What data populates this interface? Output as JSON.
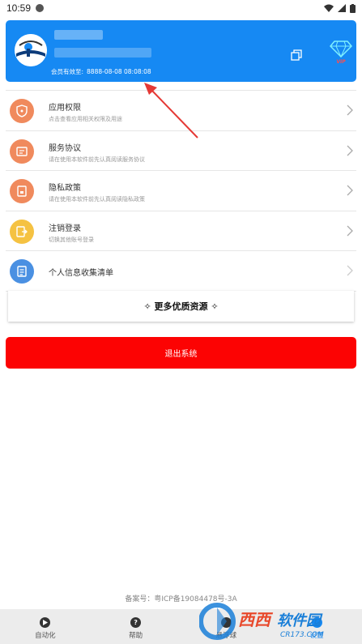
{
  "status_bar": {
    "time": "10:59"
  },
  "profile": {
    "member_label": "会员有效至:",
    "member_date": "8888-08-08 08:08:08",
    "vip_badge": "VIP"
  },
  "menu": [
    {
      "title": "应用权限",
      "subtitle": "点击查看应用相关权限及用途",
      "icon": "shield-icon",
      "color": "#f08a5d"
    },
    {
      "title": "服务协议",
      "subtitle": "请在使用本软件前先认真阅读服务协议",
      "icon": "document-icon",
      "color": "#f08a5d"
    },
    {
      "title": "隐私政策",
      "subtitle": "请在使用本软件前先认真阅读隐私政策",
      "icon": "lock-icon",
      "color": "#f08a5d"
    },
    {
      "title": "注销登录",
      "subtitle": "切换其他账号登录",
      "icon": "logout-icon",
      "color": "#f5c242"
    },
    {
      "title": "个人信息收集清单",
      "subtitle": "",
      "icon": "clipboard-icon",
      "color": "#4a90e2"
    }
  ],
  "more_resources": "✧ 更多优质资源 ✧",
  "logout_button": "退出系统",
  "icp": "备案号：粤ICP备19084478号-3A",
  "tabs": [
    {
      "label": "自动化",
      "icon": "play-icon"
    },
    {
      "label": "帮助",
      "icon": "help-icon"
    },
    {
      "label": "悬浮球",
      "icon": "float-ball-icon"
    },
    {
      "label": "设置",
      "icon": "settings-icon"
    }
  ],
  "watermark": {
    "brand": "西西软件园",
    "domain": "CR173.COM"
  },
  "colors": {
    "primary": "#1689f3",
    "danger": "#fc0303",
    "annotation": "#e53935"
  }
}
